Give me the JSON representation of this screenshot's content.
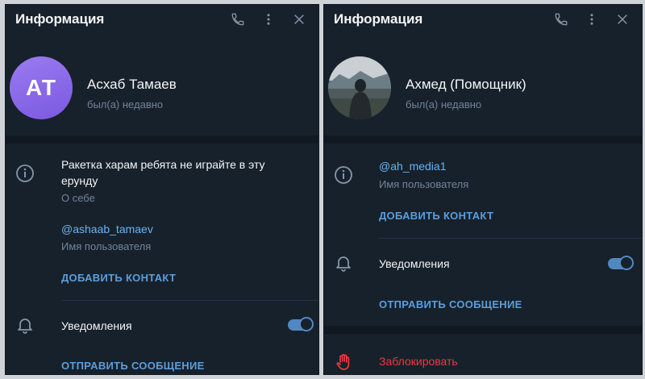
{
  "left": {
    "title": "Информация",
    "avatar_initials": "АТ",
    "name": "Асхаб Тамаев",
    "status": "был(а) недавно",
    "bio_text": "Ракетка харам ребята не играйте в эту ерунду",
    "bio_label": "О себе",
    "username": "@ashaab_tamaev",
    "username_label": "Имя пользователя",
    "add_contact": "ДОБАВИТЬ КОНТАКТ",
    "notifications_label": "Уведомления",
    "notifications_on": true,
    "send_message": "ОТПРАВИТЬ СООБЩЕНИЕ"
  },
  "right": {
    "title": "Информация",
    "name": "Ахмед (Помощник)",
    "status": "был(а) недавно",
    "username": "@ah_media1",
    "username_label": "Имя пользователя",
    "add_contact": "ДОБАВИТЬ КОНТАКТ",
    "notifications_label": "Уведомления",
    "notifications_on": true,
    "send_message": "ОТПРАВИТЬ СООБЩЕНИЕ",
    "block": "Заблокировать"
  },
  "icons": {
    "phone": "phone-icon",
    "more": "more-vertical-icon",
    "close": "close-icon",
    "info": "info-icon",
    "bell": "bell-icon",
    "hand": "hand-block-icon"
  },
  "colors": {
    "background": "#17212b",
    "accent": "#5288c1",
    "link": "#6ab3f3",
    "muted": "#708499",
    "danger": "#ec3942",
    "avatar": "#8a67e8"
  }
}
